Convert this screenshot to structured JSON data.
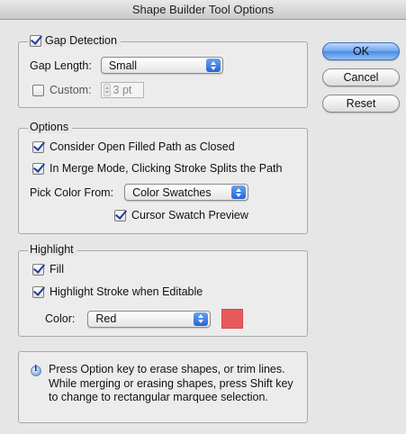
{
  "window": {
    "title": "Shape Builder Tool Options"
  },
  "buttons": {
    "ok": "OK",
    "cancel": "Cancel",
    "reset": "Reset"
  },
  "gap_detection": {
    "label": "Gap Detection",
    "checked": true,
    "gap_length_label": "Gap Length:",
    "gap_length_value": "Small",
    "custom_label": "Custom:",
    "custom_checked": false,
    "custom_value": "3 pt"
  },
  "options": {
    "label": "Options",
    "consider_open": {
      "label": "Consider Open Filled Path as Closed",
      "checked": true
    },
    "merge_mode": {
      "label": "In Merge Mode, Clicking Stroke Splits the Path",
      "checked": true
    },
    "pick_color_label": "Pick Color From:",
    "pick_color_value": "Color Swatches",
    "cursor_preview": {
      "label": "Cursor Swatch Preview",
      "checked": true
    }
  },
  "highlight": {
    "label": "Highlight",
    "fill": {
      "label": "Fill",
      "checked": true
    },
    "highlight_stroke": {
      "label": "Highlight Stroke when Editable",
      "checked": true
    },
    "color_label": "Color:",
    "color_value": "Red",
    "swatch_color": "#e85a5a"
  },
  "tip": {
    "icon": "info-icon",
    "text": "Press Option key to erase shapes, or trim lines. While merging or erasing shapes, press Shift key to change to rectangular marquee selection."
  }
}
